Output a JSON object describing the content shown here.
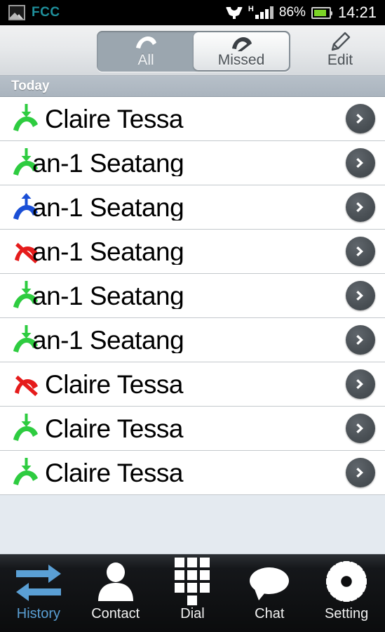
{
  "statusbar": {
    "app_badge_icon": "gallery-icon",
    "app_label": "FCC",
    "network_icon": "wifi-direct-icon",
    "network_type": "H",
    "signal_icon": "signal-bars-icon",
    "battery_percent": "86%",
    "battery_level": 86,
    "battery_icon": "battery-icon",
    "clock": "14:21"
  },
  "toolbar": {
    "tabs": [
      {
        "label": "All",
        "icon": "phone-handset-icon",
        "selected": false
      },
      {
        "label": "Missed",
        "icon": "phone-missed-icon",
        "selected": true
      }
    ],
    "edit_label": "Edit",
    "edit_icon": "pencil-icon"
  },
  "list": {
    "section_title": "Today",
    "rows": [
      {
        "name": "Claire Tessa",
        "call_type": "incoming",
        "icon": "call-incoming-icon",
        "clipped": false
      },
      {
        "name": "an-1 Seatang",
        "call_type": "incoming",
        "icon": "call-incoming-icon",
        "clipped": true
      },
      {
        "name": "an-1 Seatang",
        "call_type": "outgoing",
        "icon": "call-outgoing-icon",
        "clipped": true
      },
      {
        "name": "an-1 Seatang",
        "call_type": "missed",
        "icon": "call-missed-icon",
        "clipped": true
      },
      {
        "name": "an-1 Seatang",
        "call_type": "incoming",
        "icon": "call-incoming-icon",
        "clipped": true
      },
      {
        "name": "an-1 Seatang",
        "call_type": "incoming",
        "icon": "call-incoming-icon",
        "clipped": true
      },
      {
        "name": "Claire Tessa",
        "call_type": "missed",
        "icon": "call-missed-icon",
        "clipped": false
      },
      {
        "name": "Claire Tessa",
        "call_type": "incoming",
        "icon": "call-incoming-icon",
        "clipped": false
      },
      {
        "name": "Claire Tessa",
        "call_type": "incoming",
        "icon": "call-incoming-icon",
        "clipped": false
      }
    ],
    "detail_icon": "chevron-right-icon"
  },
  "bottomnav": {
    "items": [
      {
        "label": "History",
        "icon": "exchange-arrows-icon",
        "active": true
      },
      {
        "label": "Contact",
        "icon": "person-icon",
        "active": false
      },
      {
        "label": "Dial",
        "icon": "keypad-icon",
        "active": false
      },
      {
        "label": "Chat",
        "icon": "speech-bubble-icon",
        "active": false
      },
      {
        "label": "Setting",
        "icon": "gear-icon",
        "active": false
      }
    ]
  },
  "colors": {
    "incoming": "#2ecc40",
    "outgoing": "#1a4fd6",
    "missed": "#e51b1b",
    "active_nav": "#5a9fd4",
    "brand_label": "#1f8f9b",
    "battery_fill": "#7cd426"
  }
}
